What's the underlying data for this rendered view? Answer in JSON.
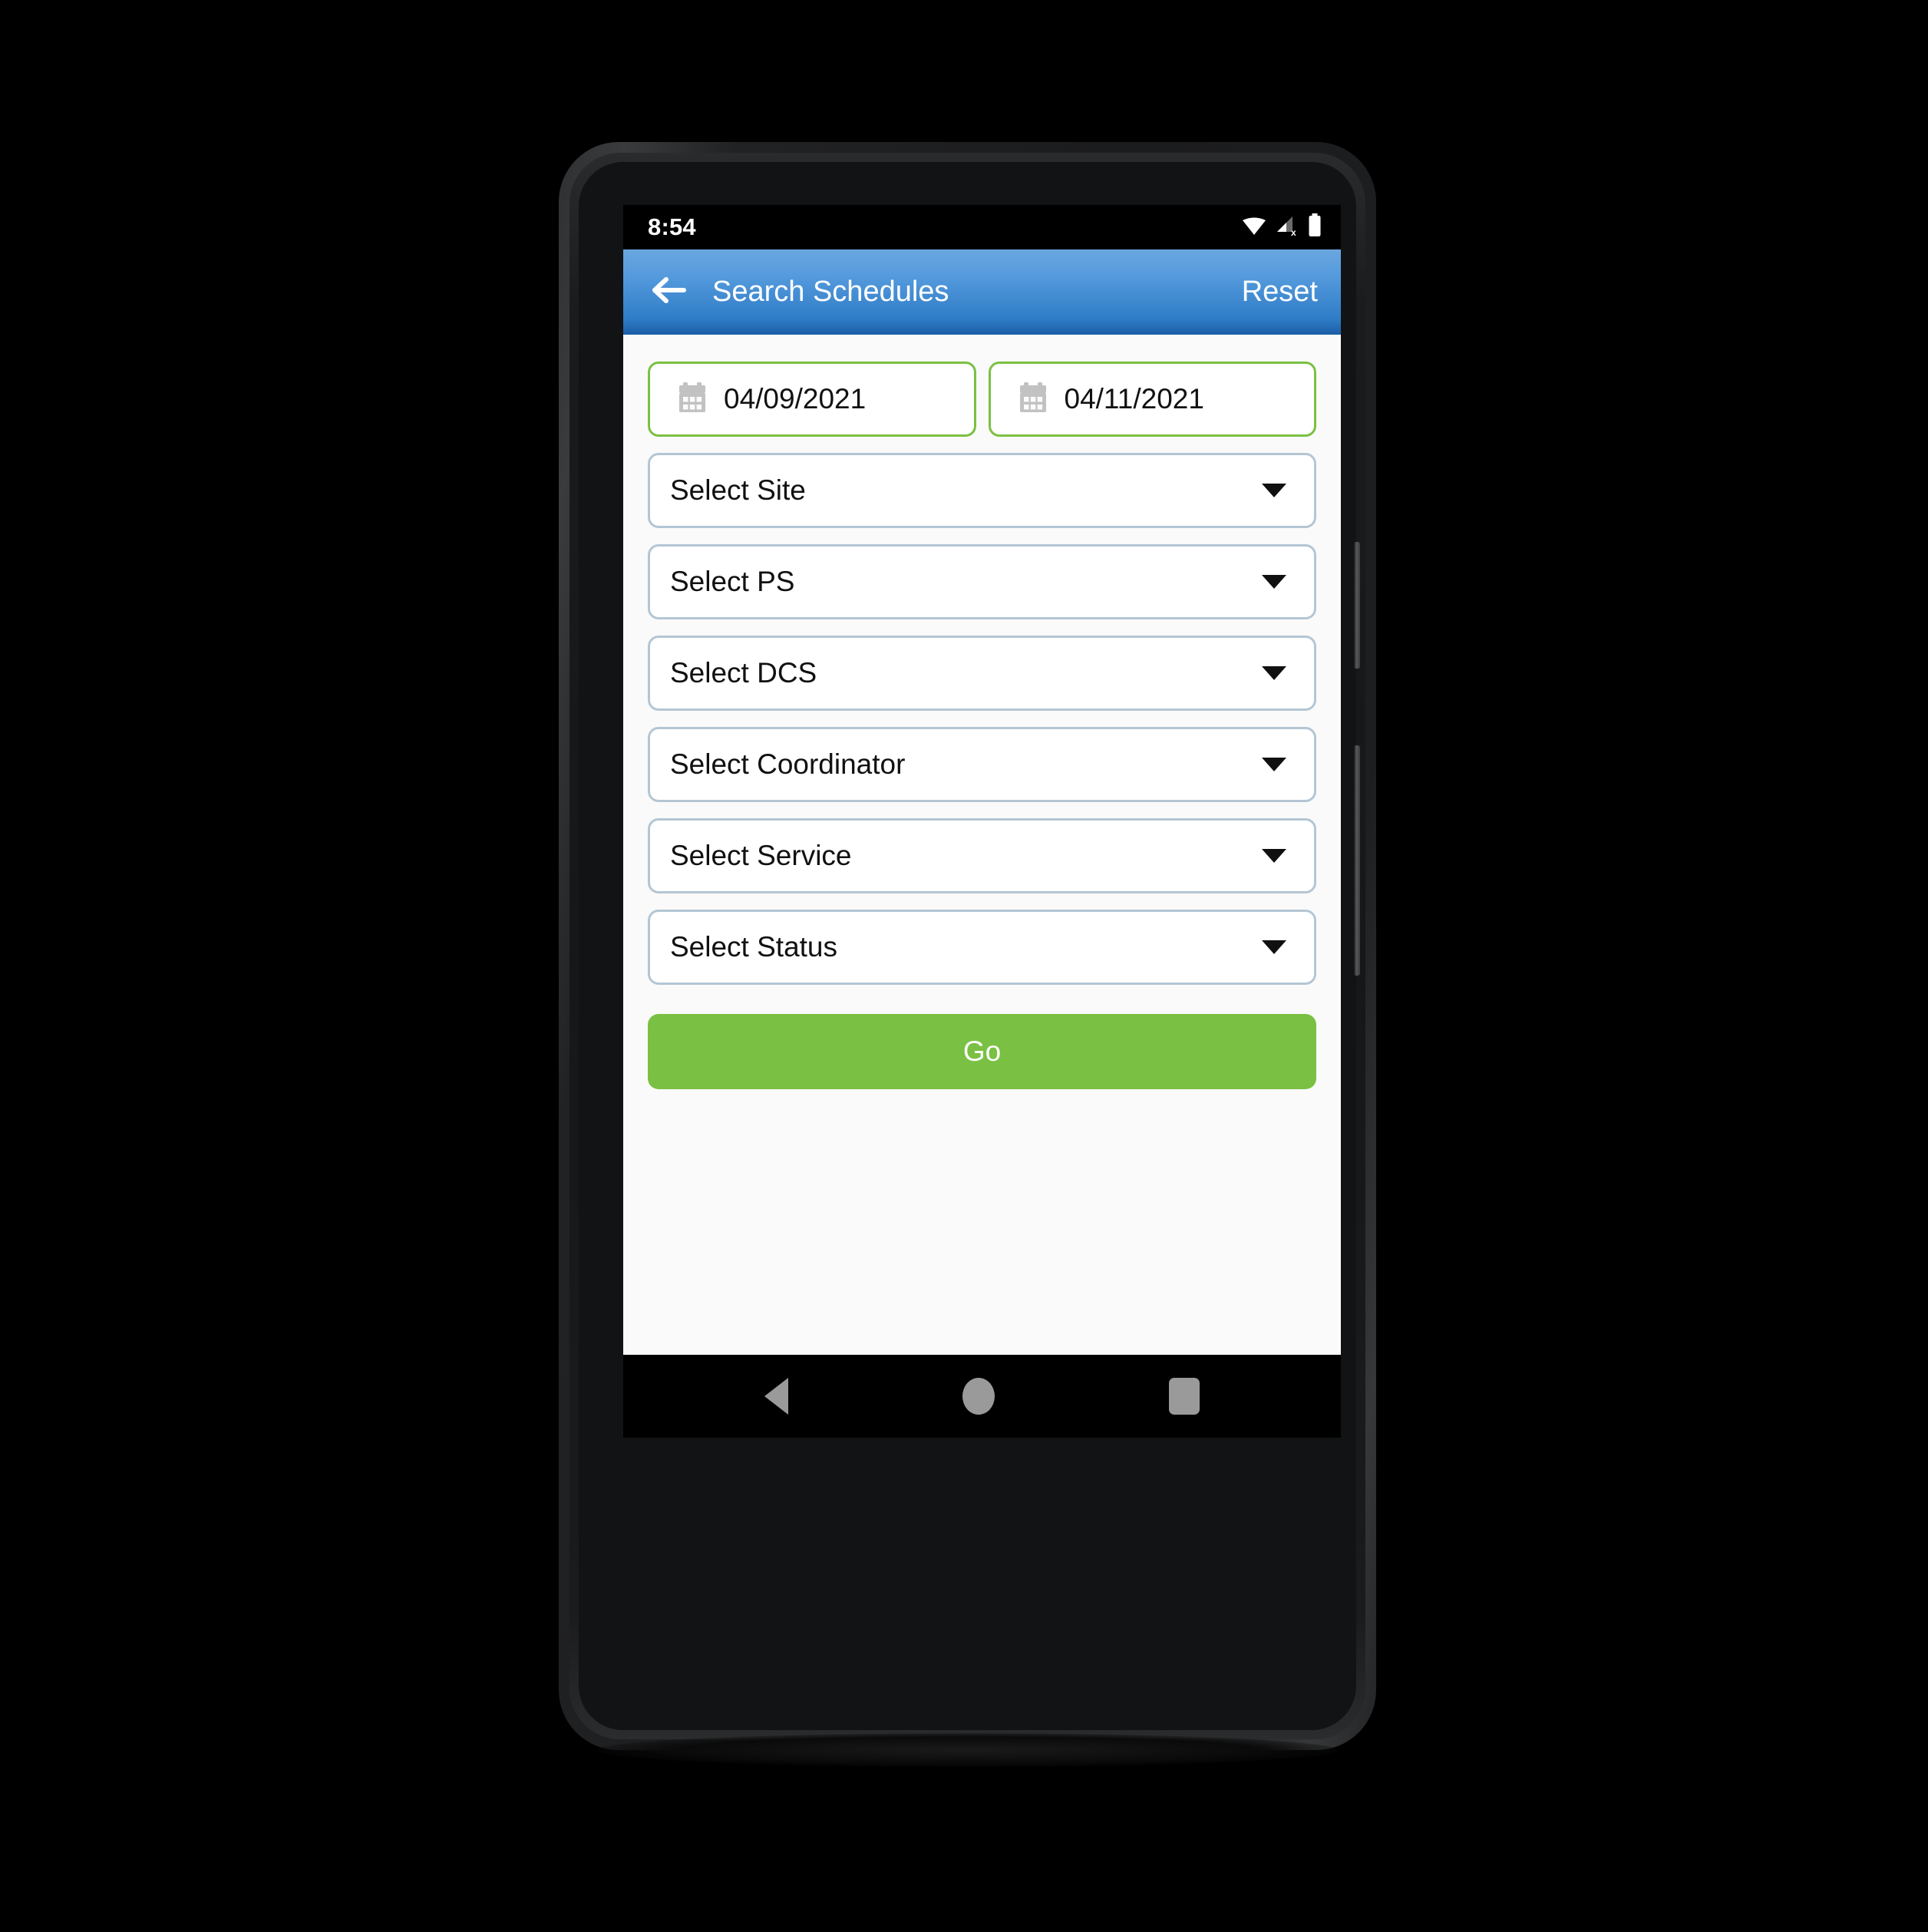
{
  "status_bar": {
    "time": "8:54",
    "icons": [
      "wifi-icon",
      "cellular-signal-no-sim-icon",
      "battery-full-icon"
    ]
  },
  "app_bar": {
    "back_icon": "arrow-left-icon",
    "title": "Search Schedules",
    "reset_label": "Reset",
    "background_top_color": "#6aa7e0",
    "background_bottom_color": "#1b5da5"
  },
  "form": {
    "date_range": [
      {
        "icon": "calendar-icon",
        "value": "04/09/2021",
        "name": "start-date"
      },
      {
        "icon": "calendar-icon",
        "value": "04/11/2021",
        "name": "end-date"
      }
    ],
    "selects": [
      {
        "label": "Select Site",
        "name": "site"
      },
      {
        "label": "Select PS",
        "name": "ps"
      },
      {
        "label": "Select DCS",
        "name": "dcs"
      },
      {
        "label": "Select Coordinator",
        "name": "coordinator"
      },
      {
        "label": "Select Service",
        "name": "service"
      },
      {
        "label": "Select Status",
        "name": "status"
      }
    ],
    "submit_label": "Go",
    "accent_green": "#7ac143",
    "select_border_color": "#b4c6d4"
  },
  "nav_bar": {
    "back": "back-triangle-icon",
    "home": "home-circle-icon",
    "recents": "recents-square-icon"
  }
}
